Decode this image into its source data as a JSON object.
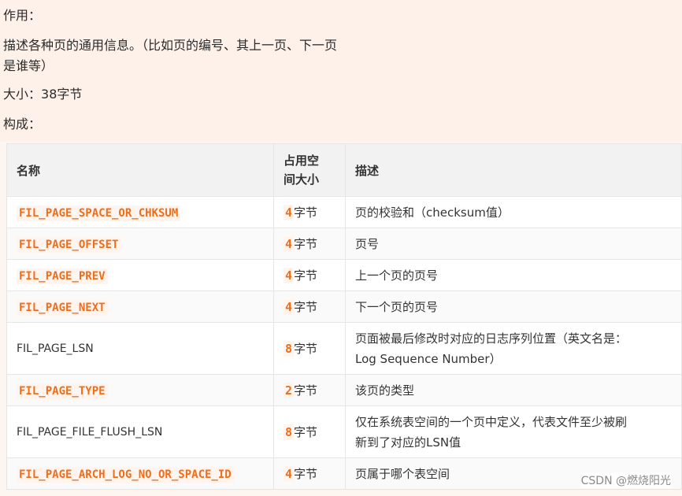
{
  "intro": {
    "usage_label": "作用：",
    "usage_desc_1": "描述各种页的通用信息。（比如页的编号、其上一页、下一页",
    "usage_desc_2": "是谁等）",
    "size_prefix": "大小：",
    "size_value": "38",
    "size_unit": "字节",
    "structure_label": "构成："
  },
  "table": {
    "headers": [
      "名称",
      "占用空间大小",
      "描述"
    ],
    "header_size_line1": "占用空",
    "header_size_line2": "间大小",
    "rows": [
      {
        "name": "FIL_PAGE_SPACE_OR_CHKSUM",
        "code": true,
        "size": "4",
        "unit": "字节",
        "desc": "页的校验和（checksum值）",
        "desc2": ""
      },
      {
        "name": "FIL_PAGE_OFFSET",
        "code": true,
        "size": "4",
        "unit": "字节",
        "desc": "页号",
        "desc2": ""
      },
      {
        "name": "FIL_PAGE_PREV",
        "code": true,
        "size": "4",
        "unit": "字节",
        "desc": "上一个页的页号",
        "desc2": ""
      },
      {
        "name": "FIL_PAGE_NEXT",
        "code": true,
        "size": "4",
        "unit": "字节",
        "desc": "下一个页的页号",
        "desc2": ""
      },
      {
        "name": "FIL_PAGE_LSN",
        "code": false,
        "size": "8",
        "unit": "字节",
        "desc": "页面被最后修改时对应的日志序列位置（英文名是：",
        "desc2": "Log Sequence Number）"
      },
      {
        "name": "FIL_PAGE_TYPE",
        "code": true,
        "size": "2",
        "unit": "字节",
        "desc": "该页的类型",
        "desc2": ""
      },
      {
        "name": "FIL_PAGE_FILE_FLUSH_LSN",
        "code": false,
        "size": "8",
        "unit": "字节",
        "desc": "仅在系统表空间的一个页中定义，代表文件至少被刷",
        "desc2": "新到了对应的LSN值"
      },
      {
        "name": "FIL_PAGE_ARCH_LOG_NO_OR_SPACE_ID",
        "code": true,
        "size": "4",
        "unit": "字节",
        "desc": "页属于哪个表空间",
        "desc2": ""
      }
    ]
  },
  "watermark": "CSDN @燃烧阳光"
}
